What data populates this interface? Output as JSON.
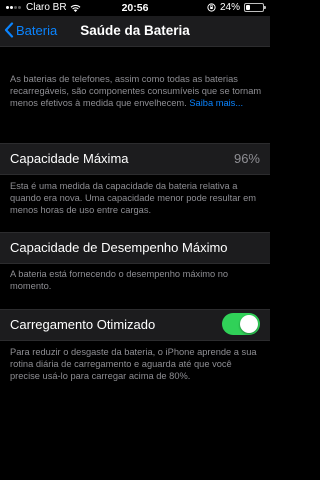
{
  "status_bar": {
    "carrier": "Claro BR",
    "time": "20:56",
    "battery_percent": "24%",
    "battery_level": 0.24
  },
  "nav": {
    "back_label": "Bateria",
    "title": "Saúde da Bateria"
  },
  "intro": {
    "text": "As baterias de telefones, assim como todas as baterias recarregáveis, são componentes consumíveis que se tornam menos efetivos à medida que envelhecem.",
    "link": "Saiba mais..."
  },
  "max_capacity": {
    "label": "Capacidade Máxima",
    "value": "96%",
    "footer": "Esta é uma medida da capacidade da bateria relativa a quando era nova. Uma capacidade menor pode resultar em menos horas de uso entre cargas."
  },
  "peak_performance": {
    "label": "Capacidade de Desempenho Máximo",
    "footer": "A bateria está fornecendo o desempenho máximo no momento."
  },
  "optimized_charging": {
    "label": "Carregamento Otimizado",
    "enabled": true,
    "footer": "Para reduzir o desgaste da bateria, o iPhone aprende a sua rotina diária de carregamento e aguarda até que você precise usá-lo para carregar acima de 80%."
  },
  "colors": {
    "accent": "#0a84ff",
    "toggle_on": "#30d158",
    "cell_bg": "#1c1c1e",
    "secondary_text": "#8e8e93"
  }
}
